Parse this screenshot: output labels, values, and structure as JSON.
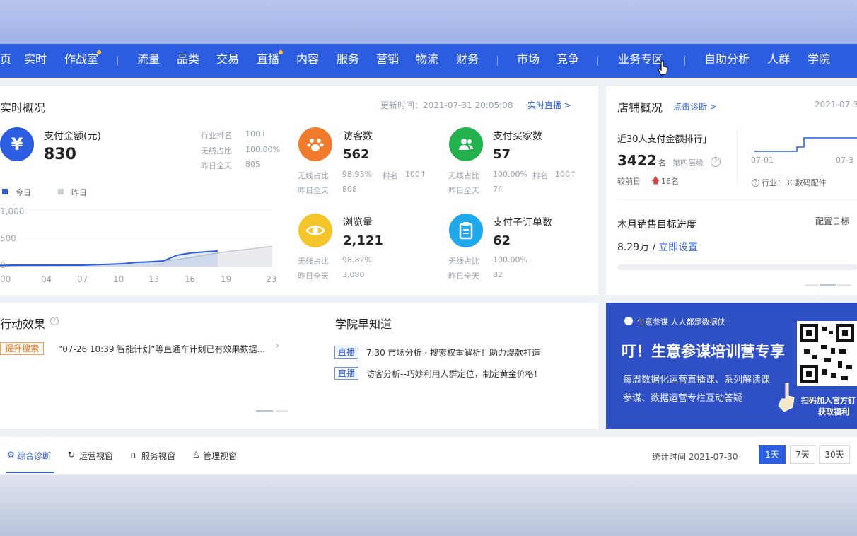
{
  "nav": {
    "items": [
      {
        "label": "页"
      },
      {
        "label": "实时"
      },
      {
        "label": "作战室"
      },
      {
        "label": "流量"
      },
      {
        "label": "品类"
      },
      {
        "label": "交易"
      },
      {
        "label": "直播"
      },
      {
        "label": "内容"
      },
      {
        "label": "服务"
      },
      {
        "label": "营销"
      },
      {
        "label": "物流"
      },
      {
        "label": "财务"
      },
      {
        "label": "市场"
      },
      {
        "label": "竞争"
      },
      {
        "label": "业务专区"
      },
      {
        "label": "自助分析"
      },
      {
        "label": "人群"
      },
      {
        "label": "学院"
      }
    ]
  },
  "realtime": {
    "title": "实时概况",
    "update_label": "更新时间：2021-07-31 20:05:08",
    "live_link": "实时直播 >",
    "pay": {
      "label": "支付金额(元)",
      "value": "830"
    },
    "rank_rows": [
      {
        "k": "行业排名",
        "v": "100+"
      },
      {
        "k": "无线占比",
        "v": "100.00%"
      },
      {
        "k": "昨日全天",
        "v": "805"
      }
    ],
    "legend": {
      "today": "今日",
      "yesterday": "昨日"
    },
    "y_ticks": [
      "1,000",
      "500",
      "0"
    ],
    "x_ticks": [
      "00",
      "04",
      "07",
      "10",
      "13",
      "16",
      "19",
      "23"
    ],
    "metrics": [
      {
        "label": "访客数",
        "value": "562",
        "r1k": "无线占比",
        "r1v": "98.93%",
        "r1k2": "排名",
        "r1v2": "100↑",
        "r2k": "昨日全天",
        "r2v": "808"
      },
      {
        "label": "支付买家数",
        "value": "57",
        "r1k": "无线占比",
        "r1v": "100.00%",
        "r1k2": "排名",
        "r1v2": "100↑",
        "r2k": "昨日全天",
        "r2v": "74"
      },
      {
        "label": "浏览量",
        "value": "2,121",
        "r1k": "无线占比",
        "r1v": "98.82%",
        "r2k": "昨日全天",
        "r2v": "3,080"
      },
      {
        "label": "支付子订单数",
        "value": "62",
        "r1k": "无线占比",
        "r1v": "100.00%",
        "r2k": "昨日全天",
        "r2v": "82"
      }
    ]
  },
  "store": {
    "title": "店铺概况",
    "diag_link": "点击诊断 >",
    "date_right": "2021-07-3",
    "rank_title": "近30人支付金额排行」",
    "rank_value": "3422",
    "rank_unit": "名",
    "rank_level": "第四层级",
    "compare_label": "较前日",
    "compare_value": "16名",
    "chart_x": [
      "07-01",
      "07-3"
    ],
    "industry": "行业：3C数码配件",
    "goal_title": "木月销售目标进度",
    "goal_config": "配置日标",
    "goal_value": "8.29万 / ",
    "goal_link": "立即设置"
  },
  "action": {
    "title": "行动效果",
    "tag": "提升搜索",
    "text": "“07-26 10:39 智能计划”等直通车计划已有效果数据..."
  },
  "academy": {
    "title": "学院早知道",
    "items": [
      {
        "tag": "直播",
        "text": "7.30 市场分析 · 搜索权重解析！助力爆款打造"
      },
      {
        "tag": "直播",
        "text": "访客分析--巧妙利用人群定位，制定黄金价格！"
      }
    ]
  },
  "banner": {
    "brand": "生意参谋  人人都是数据侠",
    "headline": "叮！生意参谋培训营专享",
    "line1": "每周数据化运营直播课、系列解读课",
    "line2": "参谋、数据运营专栏互动答疑",
    "scan1": "扫码加入官方钉",
    "scan2": "获取福利"
  },
  "tabs": {
    "items": [
      {
        "label": "综合诊断"
      },
      {
        "label": "运营视窗"
      },
      {
        "label": "服务视窗"
      },
      {
        "label": "管理视窗"
      }
    ],
    "stat_time": "统计时间 2021-07-30",
    "ranges": [
      {
        "label": "1天"
      },
      {
        "label": "7天"
      },
      {
        "label": "30天"
      }
    ]
  },
  "chart_data": {
    "type": "area",
    "x": [
      0,
      1,
      2,
      3,
      4,
      5,
      6,
      7,
      8,
      9,
      10,
      11,
      12,
      13,
      14,
      15,
      16,
      17,
      18,
      19,
      20
    ],
    "series": [
      {
        "name": "今日",
        "values": [
          20,
          25,
          25,
          25,
          25,
          25,
          25,
          35,
          40,
          50,
          75,
          85,
          100,
          200,
          240,
          260,
          275,
          280,
          285,
          290,
          290
        ]
      },
      {
        "name": "昨日",
        "values": [
          10,
          12,
          15,
          18,
          20,
          22,
          25,
          30,
          40,
          55,
          70,
          85,
          100,
          125,
          160,
          205,
          240,
          275,
          300,
          330,
          360
        ]
      }
    ],
    "ylim": [
      0,
      1000
    ],
    "colors": {
      "today": "#2c5de0",
      "yesterday": "#c6cad2"
    }
  }
}
